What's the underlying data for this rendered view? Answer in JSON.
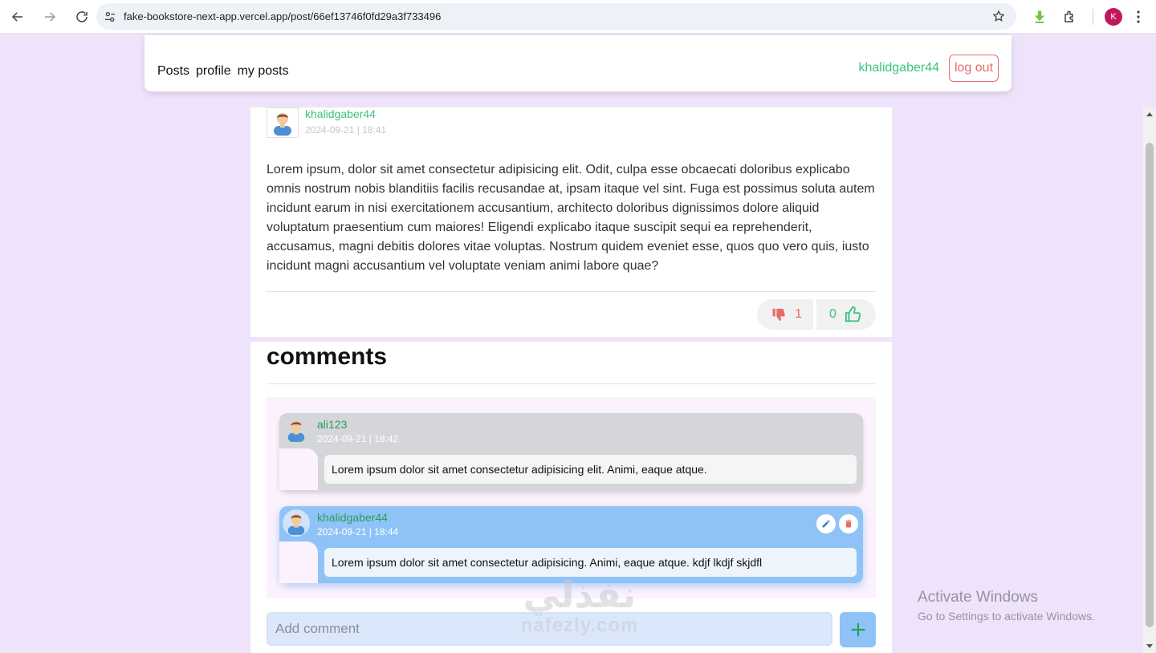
{
  "browser": {
    "url": "fake-bookstore-next-app.vercel.app/post/66ef13746f0fd29a3f733496",
    "profile_initial": "K"
  },
  "navbar": {
    "links": [
      "Posts",
      "profile",
      "my posts"
    ],
    "username": "khalidgaber44",
    "logout_label": "log out"
  },
  "post": {
    "author": "khalidgaber44",
    "date": "2024-09-21 | 18:41",
    "body": "Lorem ipsum, dolor sit amet consectetur adipisicing elit. Odit, culpa esse obcaecati doloribus explicabo omnis nostrum nobis blanditiis facilis recusandae at, ipsam itaque vel sint. Fuga est possimus soluta autem incidunt earum in nisi exercitationem accusantium, architecto doloribus dignissimos dolore aliquid voluptatum praesentium cum maiores! Eligendi explicabo itaque suscipit sequi ea reprehenderit, accusamus, magni debitis dolores vitae voluptas. Nostrum quidem eveniet esse, quos quo vero quis, iusto incidunt magni accusantium vel voluptate veniam animi labore quae?",
    "dislikes": "1",
    "likes": "0"
  },
  "comments": {
    "title": "comments",
    "items": [
      {
        "author": "ali123",
        "date": "2024-09-21 | 18:42",
        "text": "Lorem ipsum dolor sit amet consectetur adipisicing elit. Animi, eaque atque."
      },
      {
        "author": "khalidgaber44",
        "date": "2024-09-21 | 18:44",
        "text": "Lorem ipsum dolor sit amet consectetur adipisicing. Animi, eaque atque. kdjf lkdjf skjdfl"
      }
    ],
    "add_placeholder": "Add comment"
  },
  "watermark": {
    "activate_title": "Activate Windows",
    "activate_sub": "Go to Settings to activate Windows.",
    "site_ar": "نفذلي",
    "site_en": "nafezly.com"
  },
  "colors": {
    "accent_green": "#3cc37a",
    "danger_red": "#e76a6a",
    "comment_blue": "#8fc3f7",
    "page_bg": "#efe3fb"
  }
}
